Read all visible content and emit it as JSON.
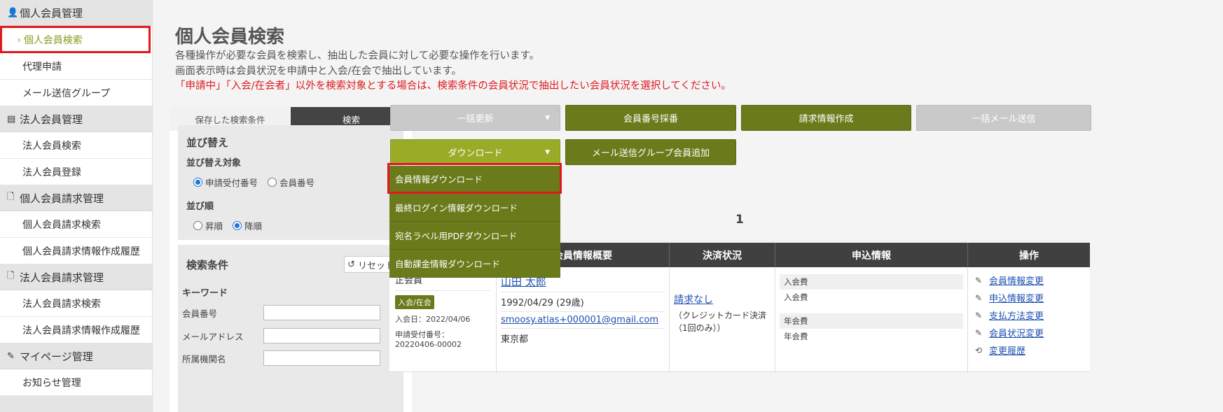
{
  "sidebar": {
    "sections": [
      {
        "icon": "person-icon",
        "label": "個人会員管理",
        "items": [
          "個人会員検索",
          "代理申請",
          "メール送信グループ"
        ]
      },
      {
        "icon": "building-icon",
        "label": "法人会員管理",
        "items": [
          "法人会員検索",
          "法人会員登録"
        ]
      },
      {
        "icon": "document-icon",
        "label": "個人会員請求管理",
        "items": [
          "個人会員請求検索",
          "個人会員請求情報作成履歴"
        ]
      },
      {
        "icon": "document-icon",
        "label": "法人会員請求管理",
        "items": [
          "法人会員請求検索",
          "法人会員請求情報作成履歴"
        ]
      },
      {
        "icon": "pen-icon",
        "label": "マイページ管理",
        "items": [
          "お知らせ管理"
        ]
      }
    ],
    "active_item": "個人会員検索"
  },
  "header": {
    "title": "個人会員検索",
    "desc1": "各種操作が必要な会員を検索し、抽出した会員に対して必要な操作を行います。",
    "desc2": "画面表示時は会員状況を申請中と入会/在会で抽出しています。",
    "warning": "「申請中」「入会/在会者」以外を検索対象とする場合は、検索条件の会員状況で抽出したい会員状況を選択してください。"
  },
  "search_panel": {
    "tab_saved": "保存した検索条件",
    "tab_search": "検索",
    "sort_title": "並び替え",
    "sort_target_label": "並び替え対象",
    "sort_target_options": [
      "申請受付番号",
      "会員番号"
    ],
    "sort_order_label": "並び順",
    "sort_order_options": [
      "昇順",
      "降順"
    ],
    "conditions_title": "検索条件",
    "reset_label": "リセット",
    "keyword_label": "キーワード",
    "fields": [
      "会員番号",
      "メールアドレス",
      "所属機関名"
    ]
  },
  "actions": {
    "bulk_update": "一括更新",
    "member_number": "会員番号採番",
    "billing_create": "請求情報作成",
    "bulk_mail": "一括メール送信",
    "download": "ダウンロード",
    "add_mail_group": "メール送信グループ会員追加"
  },
  "download_menu": {
    "items": [
      "会員情報ダウンロード",
      "最終ログイン情報ダウンロード",
      "宛名ラベル用PDFダウンロード",
      "自動課金情報ダウンロード"
    ]
  },
  "pagination": {
    "current": "1"
  },
  "table": {
    "headers": [
      "会員情報概要",
      "決済状況",
      "申込情報",
      "操作"
    ],
    "row": {
      "member_type": "正会員",
      "status_badge": "入会/在会",
      "join_date": "入会日：2022/04/06",
      "app_no_label": "申請受付番号：",
      "app_no": "20220406-00002",
      "name": "山田 太郎",
      "birth": "1992/04/29 (29歳)",
      "email": "smoosy.atlas+000001@gmail.com",
      "pref": "東京都",
      "payment_status": "請求なし",
      "payment_method": "（クレジットカード決済（1回のみ））",
      "fee1_title": "入会費",
      "fee1_value": "入会費",
      "fee2_title": "年会費",
      "fee2_value": "年会費",
      "ops": [
        "会員情報変更",
        "申込情報変更",
        "支払方法変更",
        "会員状況変更",
        "変更履歴"
      ]
    }
  }
}
